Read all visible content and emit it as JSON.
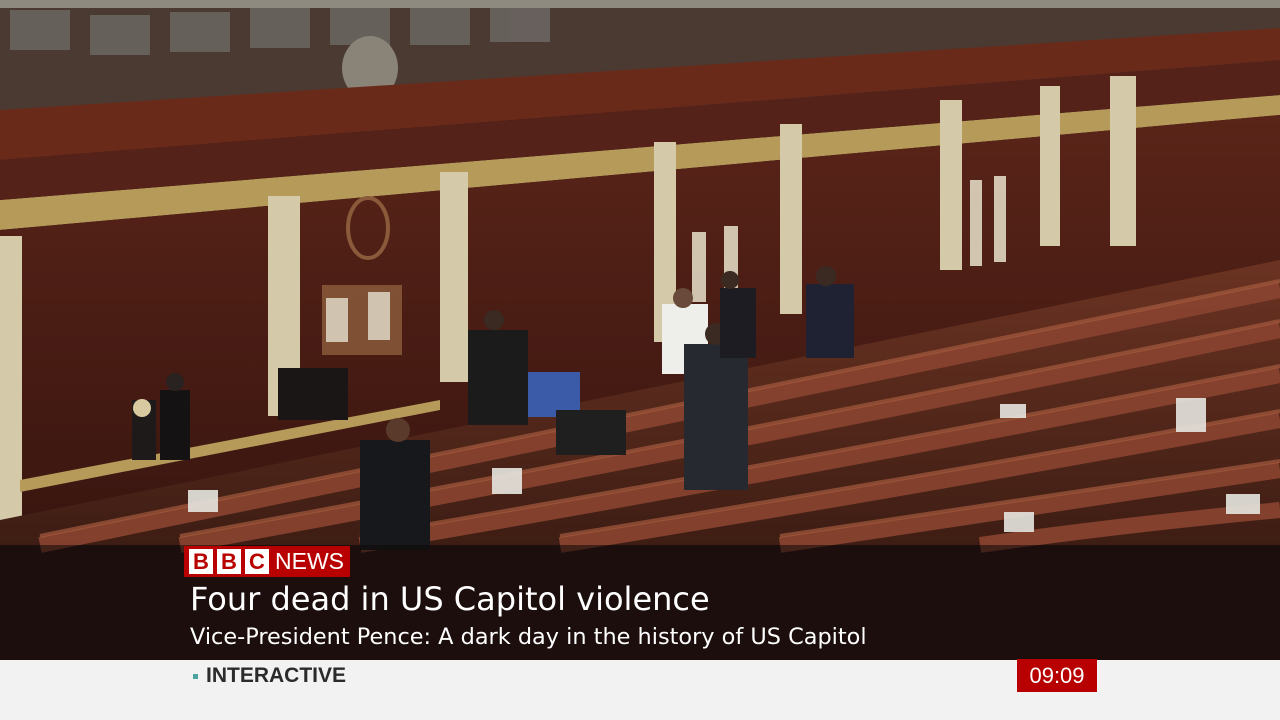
{
  "broadcaster": {
    "logo_blocks": [
      "B",
      "B",
      "C"
    ],
    "logo_word": "NEWS"
  },
  "caption": {
    "headline": "Four dead in US Capitol violence",
    "subline": "Vice-President Pence: A dark day in the history of US Capitol"
  },
  "ticker": {
    "label": "INTERACTIVE"
  },
  "clock": {
    "time": "09:09"
  },
  "colors": {
    "brand_red": "#b80000",
    "ticker_bg": "#f2f2f2",
    "ticker_bullet": "#4aa3a0"
  }
}
